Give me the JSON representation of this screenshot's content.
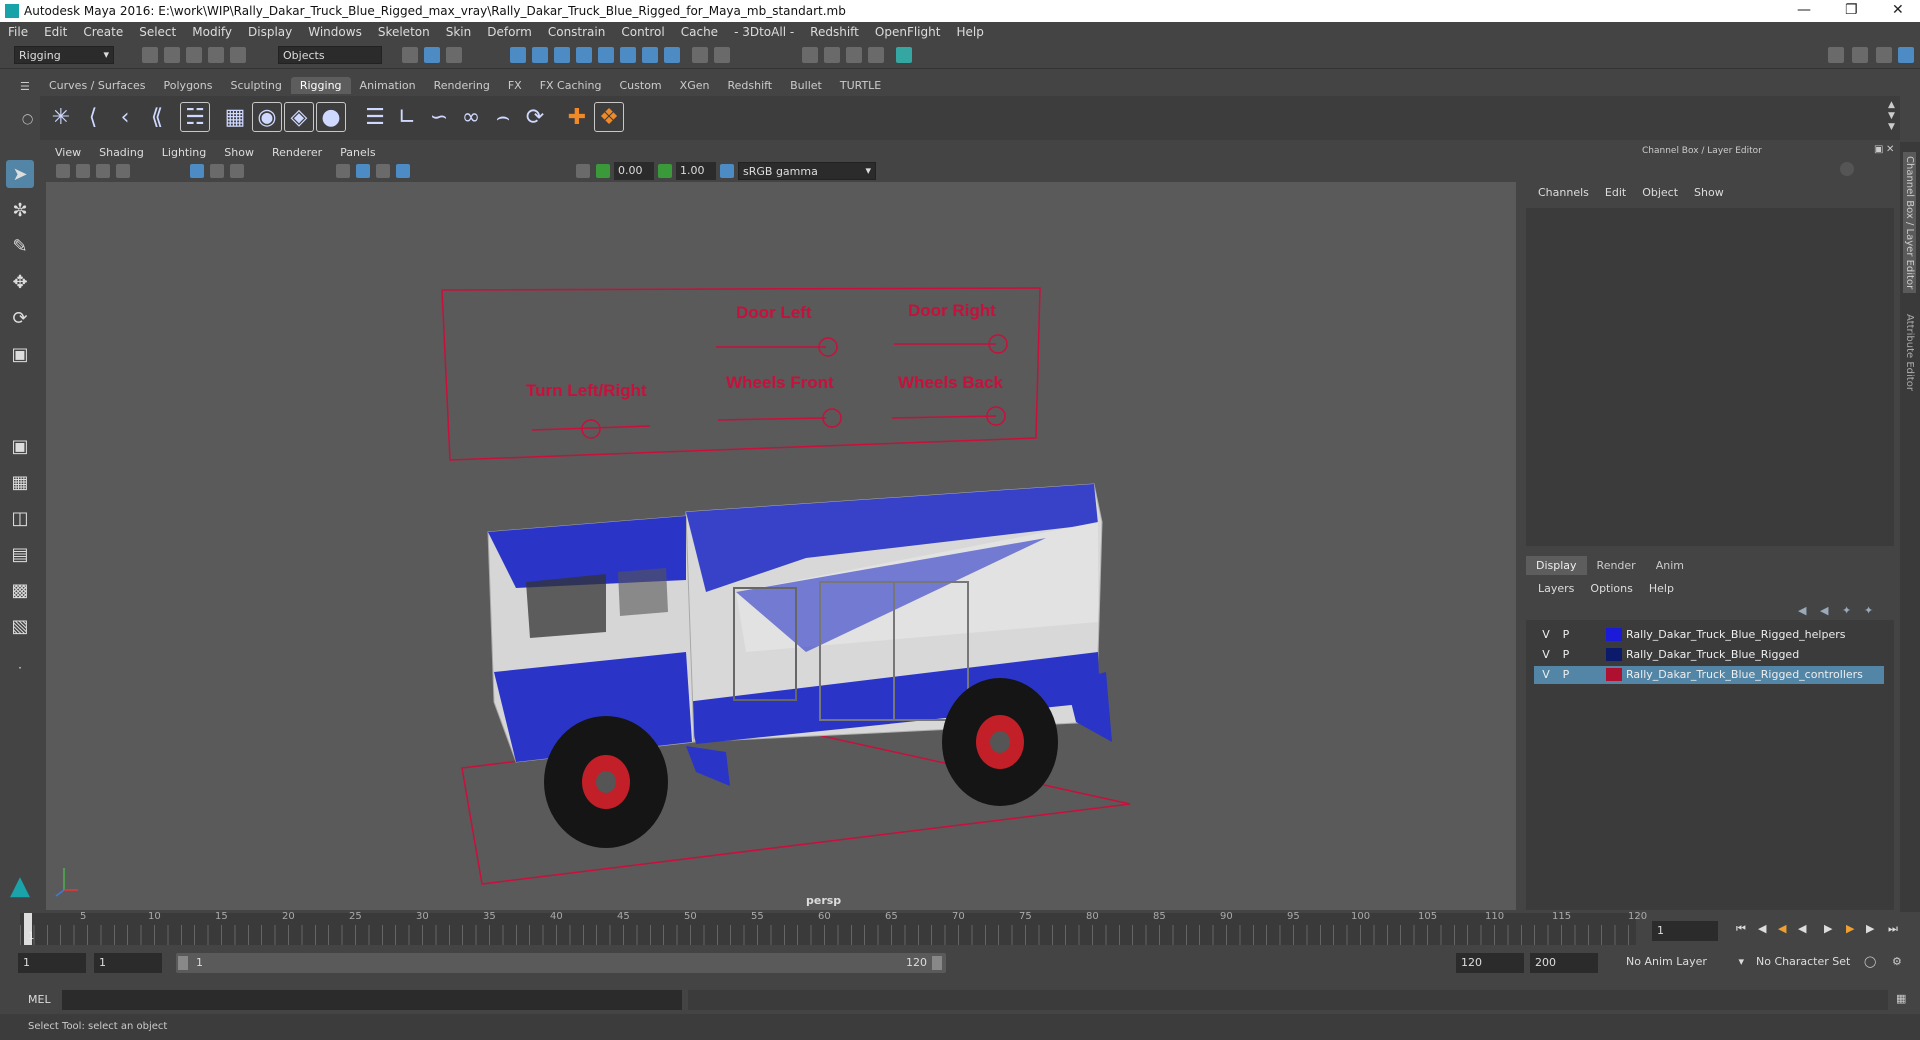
{
  "window": {
    "title": "Autodesk Maya 2016: E:\\work\\WIP\\Rally_Dakar_Truck_Blue_Rigged_max_vray\\Rally_Dakar_Truck_Blue_Rigged_for_Maya_mb_standart.mb"
  },
  "menubar": [
    "File",
    "Edit",
    "Create",
    "Select",
    "Modify",
    "Display",
    "Windows",
    "Skeleton",
    "Skin",
    "Deform",
    "Constrain",
    "Control",
    "Cache",
    "- 3DtoAll -",
    "Redshift",
    "OpenFlight",
    "Help"
  ],
  "statusline": {
    "menuset": "Rigging",
    "selection_mode": "Objects"
  },
  "shelf": {
    "tabs": [
      "Curves / Surfaces",
      "Polygons",
      "Sculpting",
      "Rigging",
      "Animation",
      "Rendering",
      "FX",
      "FX Caching",
      "Custom",
      "XGen",
      "Redshift",
      "Bullet",
      "TURTLE"
    ],
    "active_tab": "Rigging"
  },
  "viewport": {
    "menu": [
      "View",
      "Shading",
      "Lighting",
      "Show",
      "Renderer",
      "Panels"
    ],
    "exposure": "0.00",
    "gamma": "1.00",
    "color_space": "sRGB gamma",
    "camera_label": "persp",
    "controls": {
      "door_left": "Door Left",
      "door_right": "Door Right",
      "turn": "Turn  Left/Right",
      "wheels_front": "Wheels Front",
      "wheels_back": "Wheels Back"
    }
  },
  "channel_box": {
    "title": "Channel Box / Layer Editor",
    "menu": [
      "Channels",
      "Edit",
      "Object",
      "Show"
    ],
    "layer_tabs": [
      "Display",
      "Render",
      "Anim"
    ],
    "active_layer_tab": "Display",
    "layer_menu": [
      "Layers",
      "Options",
      "Help"
    ],
    "layers": [
      {
        "v": "V",
        "p": "P",
        "name": "Rally_Dakar_Truck_Blue_Rigged_helpers",
        "color": "#1a1ad8",
        "selected": false
      },
      {
        "v": "V",
        "p": "P",
        "name": "Rally_Dakar_Truck_Blue_Rigged",
        "color": "#0b1a6b",
        "selected": false
      },
      {
        "v": "V",
        "p": "P",
        "name": "Rally_Dakar_Truck_Blue_Rigged_controllers",
        "color": "#b01030",
        "selected": true
      }
    ],
    "side_tabs": [
      "Channel Box / Layer Editor",
      "Attribute Editor"
    ]
  },
  "timeline": {
    "ticks": [
      "1",
      "5",
      "10",
      "15",
      "20",
      "25",
      "30",
      "35",
      "40",
      "45",
      "50",
      "55",
      "60",
      "65",
      "70",
      "75",
      "80",
      "85",
      "90",
      "95",
      "100",
      "105",
      "110",
      "115",
      "120"
    ],
    "current_frame": "1"
  },
  "range": {
    "start": "1",
    "playback_start": "1",
    "slider_start": "1",
    "slider_end": "120",
    "playback_end": "120",
    "end": "200",
    "anim_layer": "No Anim Layer",
    "character_set": "No Character Set"
  },
  "command_line": {
    "label": "MEL"
  },
  "help_line": "Select Tool: select an object",
  "colors": {
    "accent": "#5285a6",
    "controller_red": "#c8103c",
    "truck_blue": "#2a35c8"
  }
}
